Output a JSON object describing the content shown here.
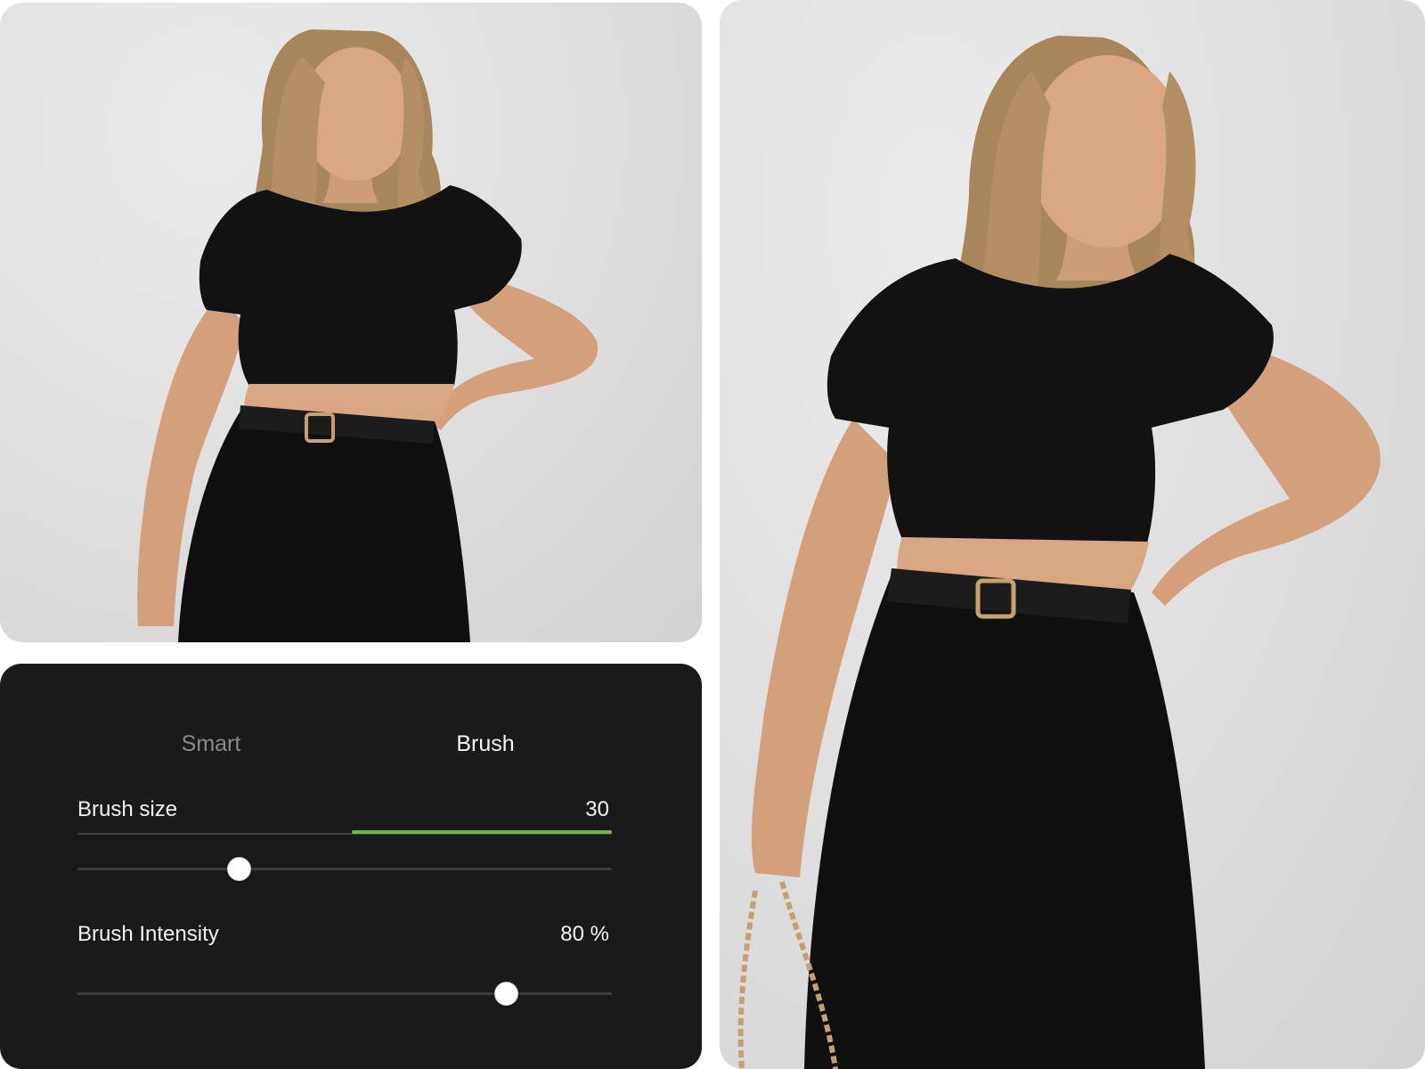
{
  "photos": {
    "before": {
      "alt": ""
    },
    "after": {
      "alt": ""
    }
  },
  "panel": {
    "tabs": [
      {
        "label": "Smart",
        "active": false
      },
      {
        "label": "Brush",
        "active": true
      }
    ],
    "brush_size": {
      "label": "Brush size",
      "value": "30",
      "level": 0.3
    },
    "brush_intensity": {
      "label": "Brush Intensity",
      "value": "80 %",
      "level": 0.8
    }
  },
  "colors": {
    "panel_bg": "#1a1a1b",
    "accent": "#6ab649",
    "inactive_tab": "#8a8a8a",
    "text": "#f2f2f2"
  }
}
